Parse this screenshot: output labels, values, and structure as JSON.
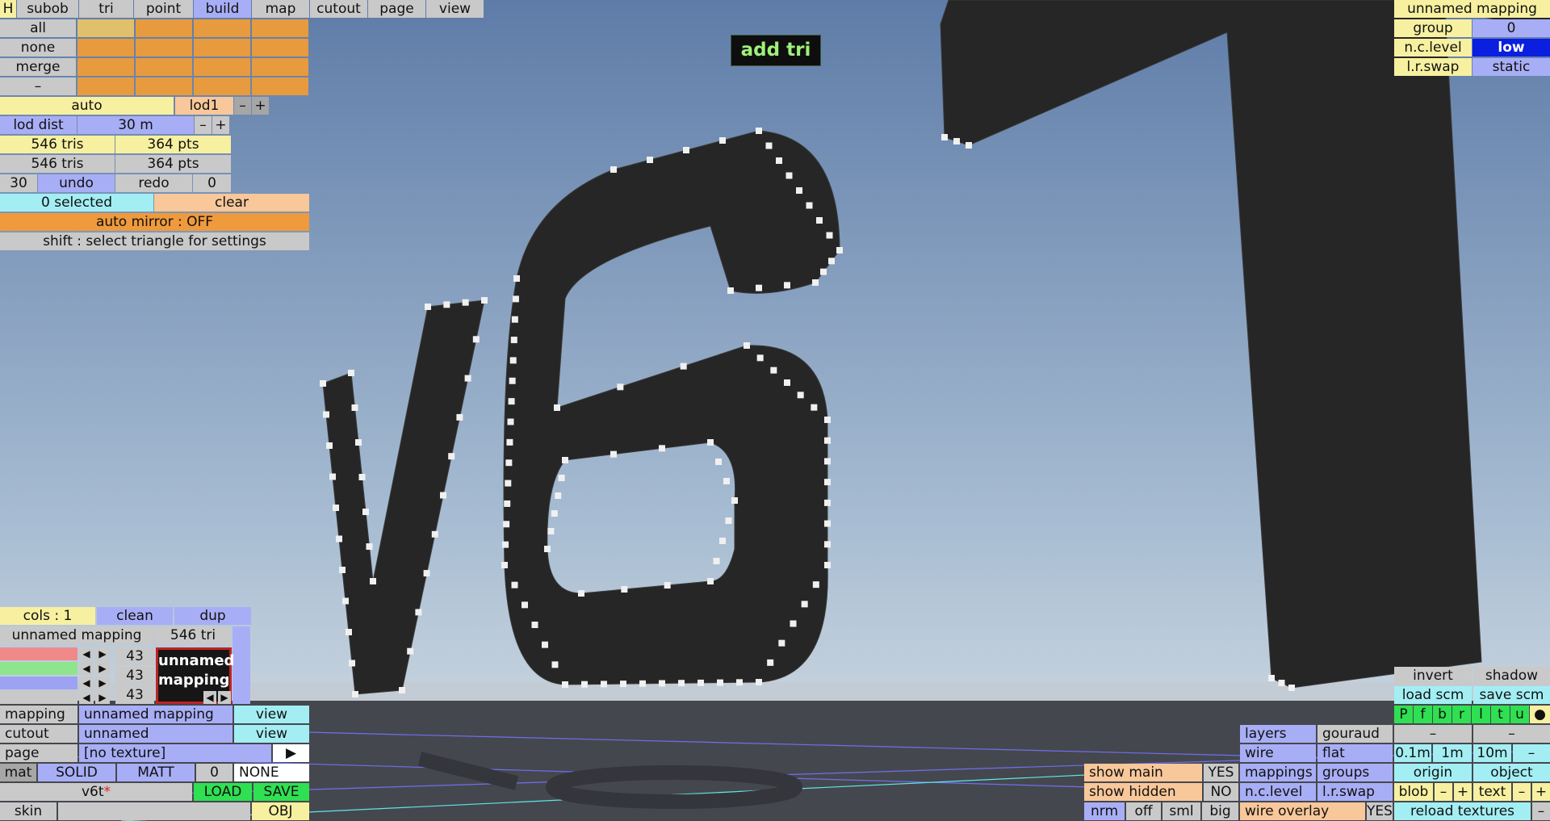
{
  "tooltip": "add tri",
  "menu": {
    "h": "H",
    "tabs": [
      "subob",
      "tri",
      "point",
      "build",
      "map",
      "cutout",
      "page",
      "view"
    ]
  },
  "select": {
    "all": "all",
    "none": "none",
    "merge": "merge",
    "dash": "–"
  },
  "lod": {
    "auto": "auto",
    "lod1": "lod1",
    "minus": "–",
    "plus": "+",
    "dist_label": "lod dist",
    "dist_value": "30 m"
  },
  "stats": {
    "tris1": "546 tris",
    "pts1": "364 pts",
    "tris2": "546 tris",
    "pts2": "364 pts"
  },
  "undo": {
    "count": "30",
    "undo": "undo",
    "redo": "redo",
    "redo_count": "0"
  },
  "selection": {
    "selected": "0 selected",
    "clear": "clear",
    "mirror": "auto mirror : OFF",
    "hint": "shift : select triangle for settings"
  },
  "mapping_panel": {
    "cols": "cols : 1",
    "clean": "clean",
    "dup": "dup",
    "name": "unnamed mapping",
    "tris": "546 tri",
    "v1": "43",
    "v2": "43",
    "v3": "43",
    "swatch_line1": "unnamed",
    "swatch_line2": "mapping",
    "rows": [
      {
        "label": "mapping",
        "value": "unnamed mapping",
        "action": "view"
      },
      {
        "label": "cutout",
        "value": "unnamed",
        "action": "view"
      }
    ],
    "page_label": "page",
    "page_value": "[no texture]",
    "play": "▶",
    "mat": "mat",
    "solid": "SOLID",
    "matt": "MATT",
    "mat_num": "0",
    "none": "NONE",
    "file": "v6t",
    "file_mark": "*",
    "load": "LOAD",
    "save": "SAVE",
    "skin": "skin",
    "obj": "OBJ"
  },
  "top_right": {
    "title": "unnamed mapping",
    "group_label": "group",
    "group_value": "0",
    "ncl_label": "n.c.level",
    "ncl_value": "low",
    "lr_label": "l.r.swap",
    "lr_value": "static"
  },
  "view_panel": {
    "show_main": "show main",
    "show_main_val": "YES",
    "show_hidden": "show hidden",
    "show_hidden_val": "NO",
    "nrm": "nrm",
    "off": "off",
    "sml": "sml",
    "big": "big",
    "layers": "layers",
    "gouraud": "gouraud",
    "wire": "wire",
    "flat": "flat",
    "mappings": "mappings",
    "groups": "groups",
    "ncl": "n.c.level",
    "lrs": "l.r.swap",
    "wire_overlay": "wire overlay",
    "wire_overlay_val": "YES"
  },
  "br_panel": {
    "invert": "invert",
    "shadow": "shadow",
    "load_scm": "load scm",
    "save_scm": "save scm",
    "flags": [
      "P",
      "f",
      "b",
      "r",
      "l",
      "t",
      "u",
      "●"
    ],
    "d1": "–",
    "d2": "–",
    "s1": "0.1m",
    "s2": "1m",
    "s3": "10m",
    "s4": "–",
    "origin": "origin",
    "object": "object",
    "blob": "blob",
    "blob_minus": "–",
    "blob_plus": "+",
    "text": "text",
    "text_minus": "–",
    "text_plus": "+",
    "reload": "reload textures",
    "reload_minus": "–"
  },
  "colors": {
    "sky_top": "#5e7ca8",
    "sky_bottom": "#a9bed3",
    "ground": "#45474e",
    "mesh": "#262626",
    "vertex": "#f0f0f0"
  }
}
